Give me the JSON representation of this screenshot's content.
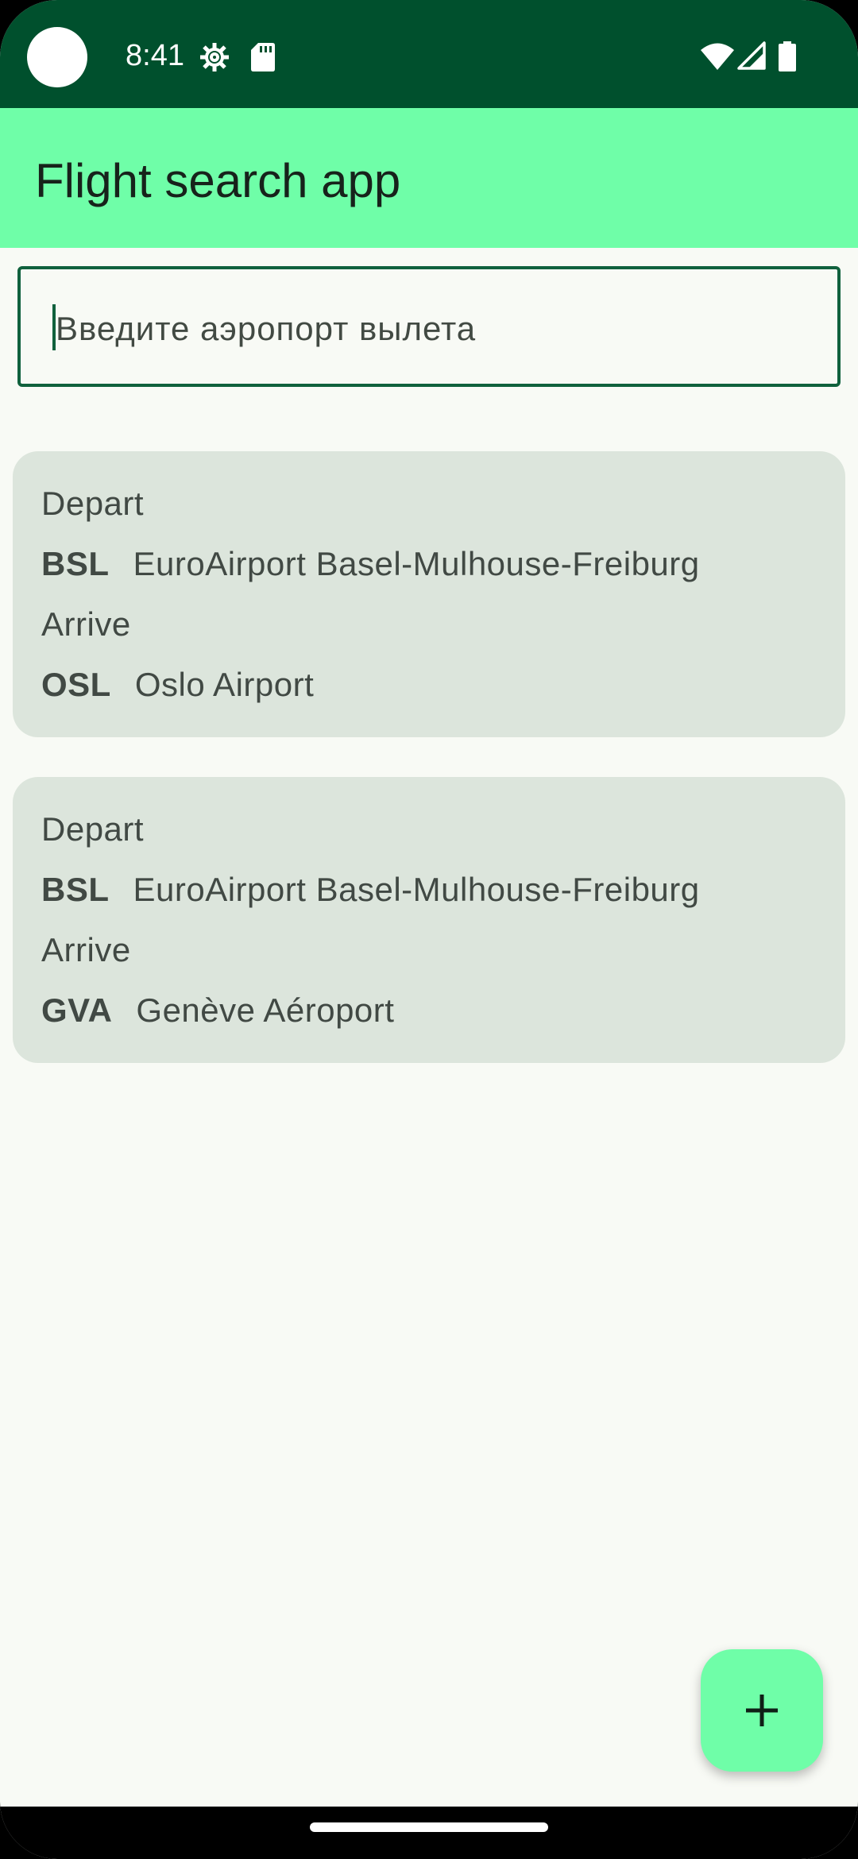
{
  "status_bar": {
    "time": "8:41",
    "icons": [
      "camera-hole",
      "gear-icon",
      "sd-card-icon",
      "wifi-icon",
      "signal-icon",
      "battery-icon"
    ]
  },
  "app_bar": {
    "title": "Flight search app"
  },
  "search": {
    "placeholder": "Введите аэропорт вылета",
    "value": ""
  },
  "flights": [
    {
      "depart_label": "Depart",
      "depart_code": "BSL",
      "depart_name": "EuroAirport Basel-Mulhouse-Freiburg",
      "arrive_label": "Arrive",
      "arrive_code": "OSL",
      "arrive_name": "Oslo Airport"
    },
    {
      "depart_label": "Depart",
      "depart_code": "BSL",
      "depart_name": "EuroAirport Basel-Mulhouse-Freiburg",
      "arrive_label": "Arrive",
      "arrive_code": "GVA",
      "arrive_name": "Genève Aéroport"
    }
  ],
  "fab": {
    "icon": "plus-icon"
  },
  "colors": {
    "status_bar": "#00502D",
    "app_bar": "#6FFEA8",
    "background": "#F8FAF5",
    "card": "#DCE5DC",
    "accent": "#10613D",
    "fab": "#6FFEA8"
  }
}
